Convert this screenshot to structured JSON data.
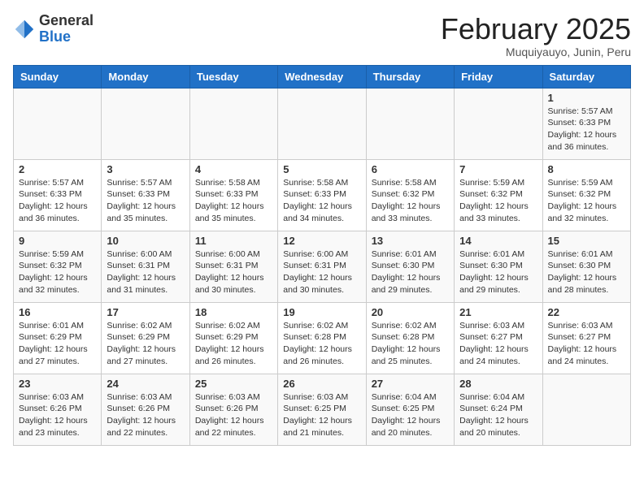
{
  "header": {
    "logo_general": "General",
    "logo_blue": "Blue",
    "month_year": "February 2025",
    "location": "Muquiyauyo, Junin, Peru"
  },
  "weekdays": [
    "Sunday",
    "Monday",
    "Tuesday",
    "Wednesday",
    "Thursday",
    "Friday",
    "Saturday"
  ],
  "weeks": [
    [
      {
        "day": "",
        "info": ""
      },
      {
        "day": "",
        "info": ""
      },
      {
        "day": "",
        "info": ""
      },
      {
        "day": "",
        "info": ""
      },
      {
        "day": "",
        "info": ""
      },
      {
        "day": "",
        "info": ""
      },
      {
        "day": "1",
        "info": "Sunrise: 5:57 AM\nSunset: 6:33 PM\nDaylight: 12 hours\nand 36 minutes."
      }
    ],
    [
      {
        "day": "2",
        "info": "Sunrise: 5:57 AM\nSunset: 6:33 PM\nDaylight: 12 hours\nand 36 minutes."
      },
      {
        "day": "3",
        "info": "Sunrise: 5:57 AM\nSunset: 6:33 PM\nDaylight: 12 hours\nand 35 minutes."
      },
      {
        "day": "4",
        "info": "Sunrise: 5:58 AM\nSunset: 6:33 PM\nDaylight: 12 hours\nand 35 minutes."
      },
      {
        "day": "5",
        "info": "Sunrise: 5:58 AM\nSunset: 6:33 PM\nDaylight: 12 hours\nand 34 minutes."
      },
      {
        "day": "6",
        "info": "Sunrise: 5:58 AM\nSunset: 6:32 PM\nDaylight: 12 hours\nand 33 minutes."
      },
      {
        "day": "7",
        "info": "Sunrise: 5:59 AM\nSunset: 6:32 PM\nDaylight: 12 hours\nand 33 minutes."
      },
      {
        "day": "8",
        "info": "Sunrise: 5:59 AM\nSunset: 6:32 PM\nDaylight: 12 hours\nand 32 minutes."
      }
    ],
    [
      {
        "day": "9",
        "info": "Sunrise: 5:59 AM\nSunset: 6:32 PM\nDaylight: 12 hours\nand 32 minutes."
      },
      {
        "day": "10",
        "info": "Sunrise: 6:00 AM\nSunset: 6:31 PM\nDaylight: 12 hours\nand 31 minutes."
      },
      {
        "day": "11",
        "info": "Sunrise: 6:00 AM\nSunset: 6:31 PM\nDaylight: 12 hours\nand 30 minutes."
      },
      {
        "day": "12",
        "info": "Sunrise: 6:00 AM\nSunset: 6:31 PM\nDaylight: 12 hours\nand 30 minutes."
      },
      {
        "day": "13",
        "info": "Sunrise: 6:01 AM\nSunset: 6:30 PM\nDaylight: 12 hours\nand 29 minutes."
      },
      {
        "day": "14",
        "info": "Sunrise: 6:01 AM\nSunset: 6:30 PM\nDaylight: 12 hours\nand 29 minutes."
      },
      {
        "day": "15",
        "info": "Sunrise: 6:01 AM\nSunset: 6:30 PM\nDaylight: 12 hours\nand 28 minutes."
      }
    ],
    [
      {
        "day": "16",
        "info": "Sunrise: 6:01 AM\nSunset: 6:29 PM\nDaylight: 12 hours\nand 27 minutes."
      },
      {
        "day": "17",
        "info": "Sunrise: 6:02 AM\nSunset: 6:29 PM\nDaylight: 12 hours\nand 27 minutes."
      },
      {
        "day": "18",
        "info": "Sunrise: 6:02 AM\nSunset: 6:29 PM\nDaylight: 12 hours\nand 26 minutes."
      },
      {
        "day": "19",
        "info": "Sunrise: 6:02 AM\nSunset: 6:28 PM\nDaylight: 12 hours\nand 26 minutes."
      },
      {
        "day": "20",
        "info": "Sunrise: 6:02 AM\nSunset: 6:28 PM\nDaylight: 12 hours\nand 25 minutes."
      },
      {
        "day": "21",
        "info": "Sunrise: 6:03 AM\nSunset: 6:27 PM\nDaylight: 12 hours\nand 24 minutes."
      },
      {
        "day": "22",
        "info": "Sunrise: 6:03 AM\nSunset: 6:27 PM\nDaylight: 12 hours\nand 24 minutes."
      }
    ],
    [
      {
        "day": "23",
        "info": "Sunrise: 6:03 AM\nSunset: 6:26 PM\nDaylight: 12 hours\nand 23 minutes."
      },
      {
        "day": "24",
        "info": "Sunrise: 6:03 AM\nSunset: 6:26 PM\nDaylight: 12 hours\nand 22 minutes."
      },
      {
        "day": "25",
        "info": "Sunrise: 6:03 AM\nSunset: 6:26 PM\nDaylight: 12 hours\nand 22 minutes."
      },
      {
        "day": "26",
        "info": "Sunrise: 6:03 AM\nSunset: 6:25 PM\nDaylight: 12 hours\nand 21 minutes."
      },
      {
        "day": "27",
        "info": "Sunrise: 6:04 AM\nSunset: 6:25 PM\nDaylight: 12 hours\nand 20 minutes."
      },
      {
        "day": "28",
        "info": "Sunrise: 6:04 AM\nSunset: 6:24 PM\nDaylight: 12 hours\nand 20 minutes."
      },
      {
        "day": "",
        "info": ""
      }
    ]
  ]
}
